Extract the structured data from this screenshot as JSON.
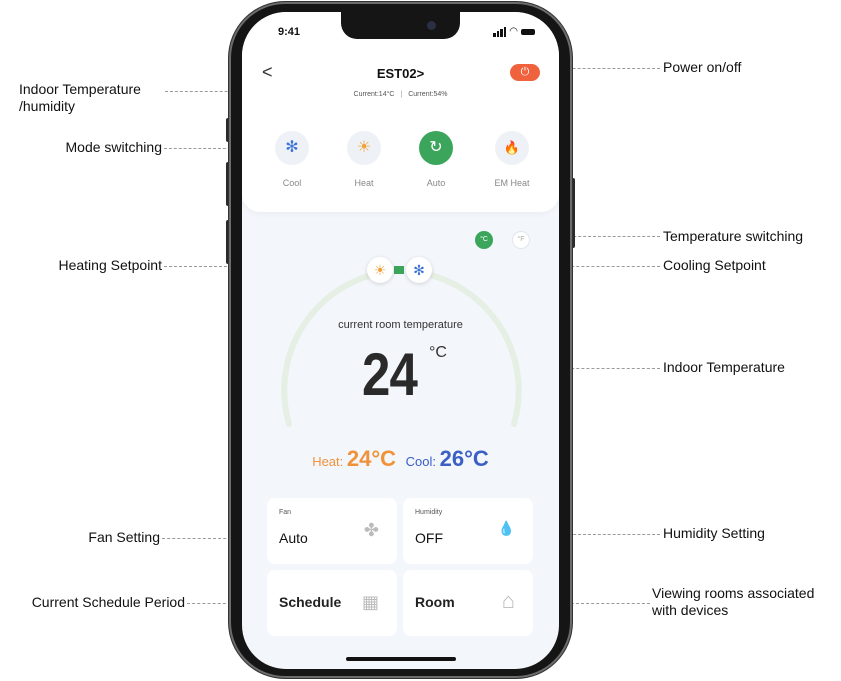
{
  "callouts": {
    "indoor_temp_humidity": "Indoor Temperature\n/humidity",
    "mode_switching": "Mode switching",
    "heating_setpoint": "Heating Setpoint",
    "fan_setting": "Fan Setting",
    "current_schedule_period": "Current Schedule Period",
    "power": "Power on/off",
    "temperature_switching": "Temperature switching",
    "cooling_setpoint": "Cooling Setpoint",
    "indoor_temperature": "Indoor Temperature",
    "humidity_setting": "Humidity Setting",
    "viewing_rooms": "Viewing rooms associated\nwith devices"
  },
  "app": {
    "status_time": "9:41",
    "device_name": "EST02>",
    "back_glyph": "<",
    "power_glyph": "⏻",
    "current_temp": "Current:14°C",
    "current_humidity": "Current:54%",
    "separator": "|",
    "modes": [
      {
        "label": "Cool",
        "icon": "snowflake-icon",
        "glyph": "✻",
        "active": false,
        "color": "#3b73d6"
      },
      {
        "label": "Heat",
        "icon": "sun-icon",
        "glyph": "☀",
        "active": false,
        "color": "#f0a23a"
      },
      {
        "label": "Auto",
        "icon": "auto-cycle-icon",
        "glyph": "↻",
        "active": true,
        "color": "#3ca55c"
      },
      {
        "label": "EM Heat",
        "icon": "flame-icon",
        "glyph": "🔥",
        "active": false,
        "color": "#f0623d"
      }
    ],
    "unit_c": "°C",
    "unit_f": "°F",
    "selected_unit": "°C",
    "heat_icon_glyph": "☀",
    "cool_icon_glyph": "✻",
    "room_temp_label": "current room temperature",
    "room_temp_value": "24",
    "room_temp_unit": "°C",
    "heat_label": "Heat:",
    "heat_value": "24°C",
    "cool_label": "Cool:",
    "cool_value": "26°C",
    "fan": {
      "title": "Fan",
      "value": "Auto",
      "icon": "fan-icon",
      "glyph": "✤"
    },
    "humidity": {
      "title": "Humidity",
      "value": "OFF",
      "icon": "water-drop-icon",
      "glyph": "💧"
    },
    "schedule": {
      "value": "Schedule",
      "icon": "calendar-icon",
      "glyph": "▦"
    },
    "room": {
      "value": "Room",
      "icon": "house-icon",
      "glyph": "⌂"
    }
  },
  "colors": {
    "accent_green": "#3ca55c",
    "power_red": "#f0623d",
    "heat_orange": "#f0923a",
    "cool_blue": "#3b5fc4"
  }
}
